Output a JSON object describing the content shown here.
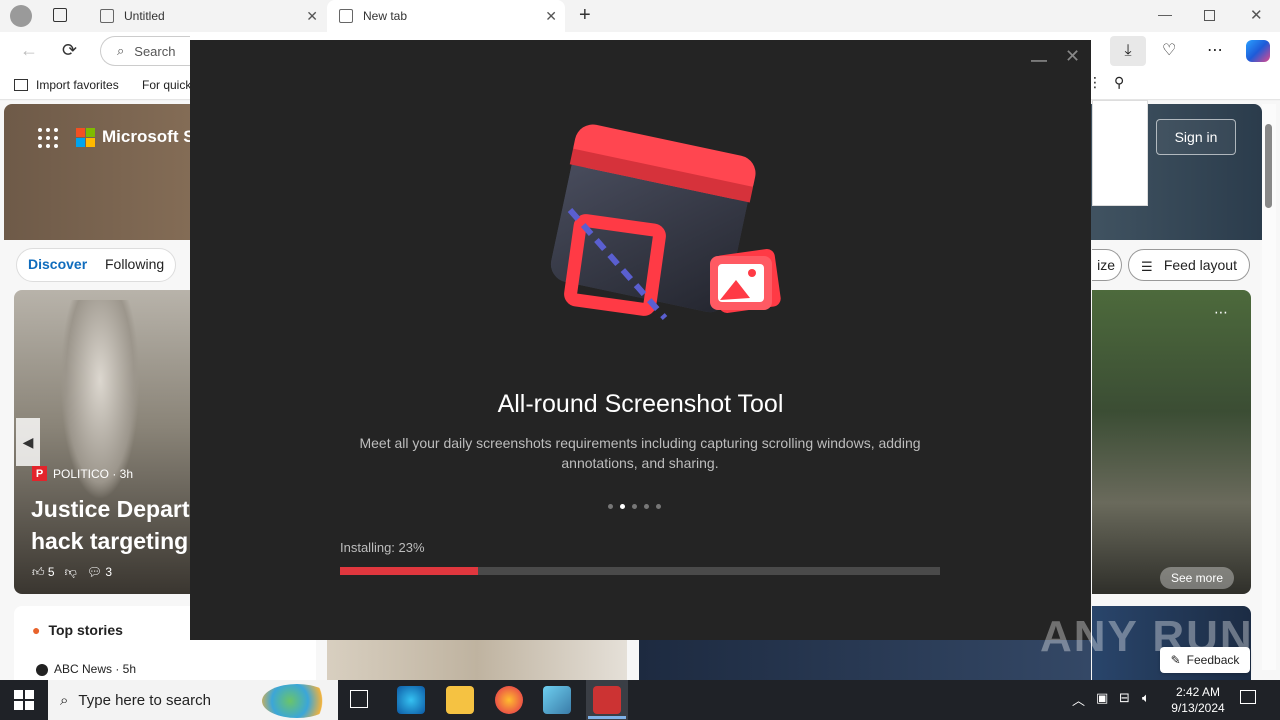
{
  "browser": {
    "tabs": [
      {
        "label": "Untitled"
      },
      {
        "label": "New tab"
      }
    ],
    "address_placeholder": "Search",
    "favorites": [
      {
        "label": "Import favorites"
      },
      {
        "label": "For quick"
      }
    ]
  },
  "msn": {
    "brand": "Microsoft St",
    "sign_in": "Sign in",
    "tabs": {
      "discover": "Discover",
      "following": "Following"
    },
    "personalize_fragment": "ize",
    "feed_layout": "Feed layout",
    "hero_card": {
      "source": "POLITICO · 3h",
      "source_letter": "P",
      "headline_line1": "Justice Depart",
      "headline_line2": "hack targeting",
      "likes": "5",
      "comments": "3"
    },
    "top_stories": "Top stories",
    "abc_news": "ABC News · 5h",
    "see_more": "See more",
    "feedback": "Feedback"
  },
  "installer": {
    "title": "All-round Screenshot Tool",
    "description": "Meet all your daily screenshots requirements including capturing scrolling windows, adding annotations, and sharing.",
    "status": "Installing: 23%",
    "progress": 0.23,
    "carousel_count": 5,
    "carousel_active": 1,
    "accent": "#e0373e"
  },
  "taskbar": {
    "search_placeholder": "Type here to search",
    "time": "2:42 AM",
    "date": "9/13/2024"
  },
  "watermark": "ANY RUN"
}
